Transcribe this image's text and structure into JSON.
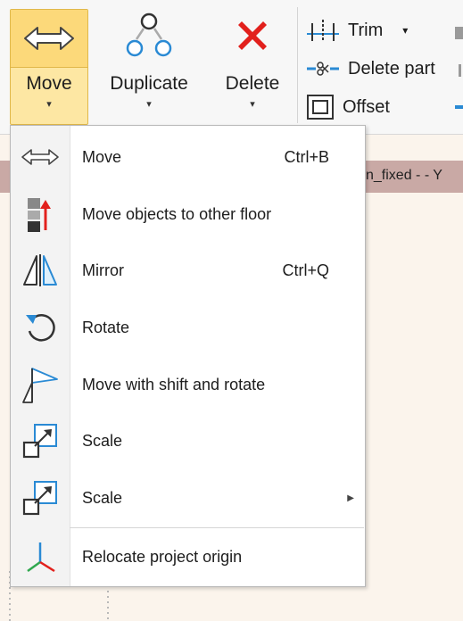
{
  "ribbon": {
    "move_label": "Move",
    "duplicate_label": "Duplicate",
    "delete_label": "Delete",
    "trim_label": "Trim",
    "delete_part_label": "Delete part",
    "offset_label": "Offset",
    "dropdown_caret": "▾"
  },
  "background_window": {
    "tab_text": "n_fixed -  - Y"
  },
  "menu": {
    "items": [
      {
        "label": "Move",
        "shortcut": "Ctrl+B",
        "icon": "double-arrow-icon"
      },
      {
        "label": "Move objects to other floor",
        "shortcut": "",
        "icon": "floor-move-icon"
      },
      {
        "label": "Mirror",
        "shortcut": "Ctrl+Q",
        "icon": "mirror-icon"
      },
      {
        "label": "Rotate",
        "shortcut": "",
        "icon": "rotate-icon"
      },
      {
        "label": "Move with shift and rotate",
        "shortcut": "",
        "icon": "shift-rotate-icon"
      },
      {
        "label": "Scale",
        "shortcut": "",
        "icon": "scale-icon"
      },
      {
        "label": "Scale",
        "shortcut": "",
        "icon": "scale-icon",
        "submenu": true
      },
      {
        "label": "Relocate project origin",
        "shortcut": "",
        "icon": "project-origin-icon"
      }
    ],
    "submenu_arrow": "▶"
  },
  "colors": {
    "accent_blue": "#2a8ad4",
    "delete_red": "#e2201c",
    "hover_yellow": "#fcd97a"
  }
}
